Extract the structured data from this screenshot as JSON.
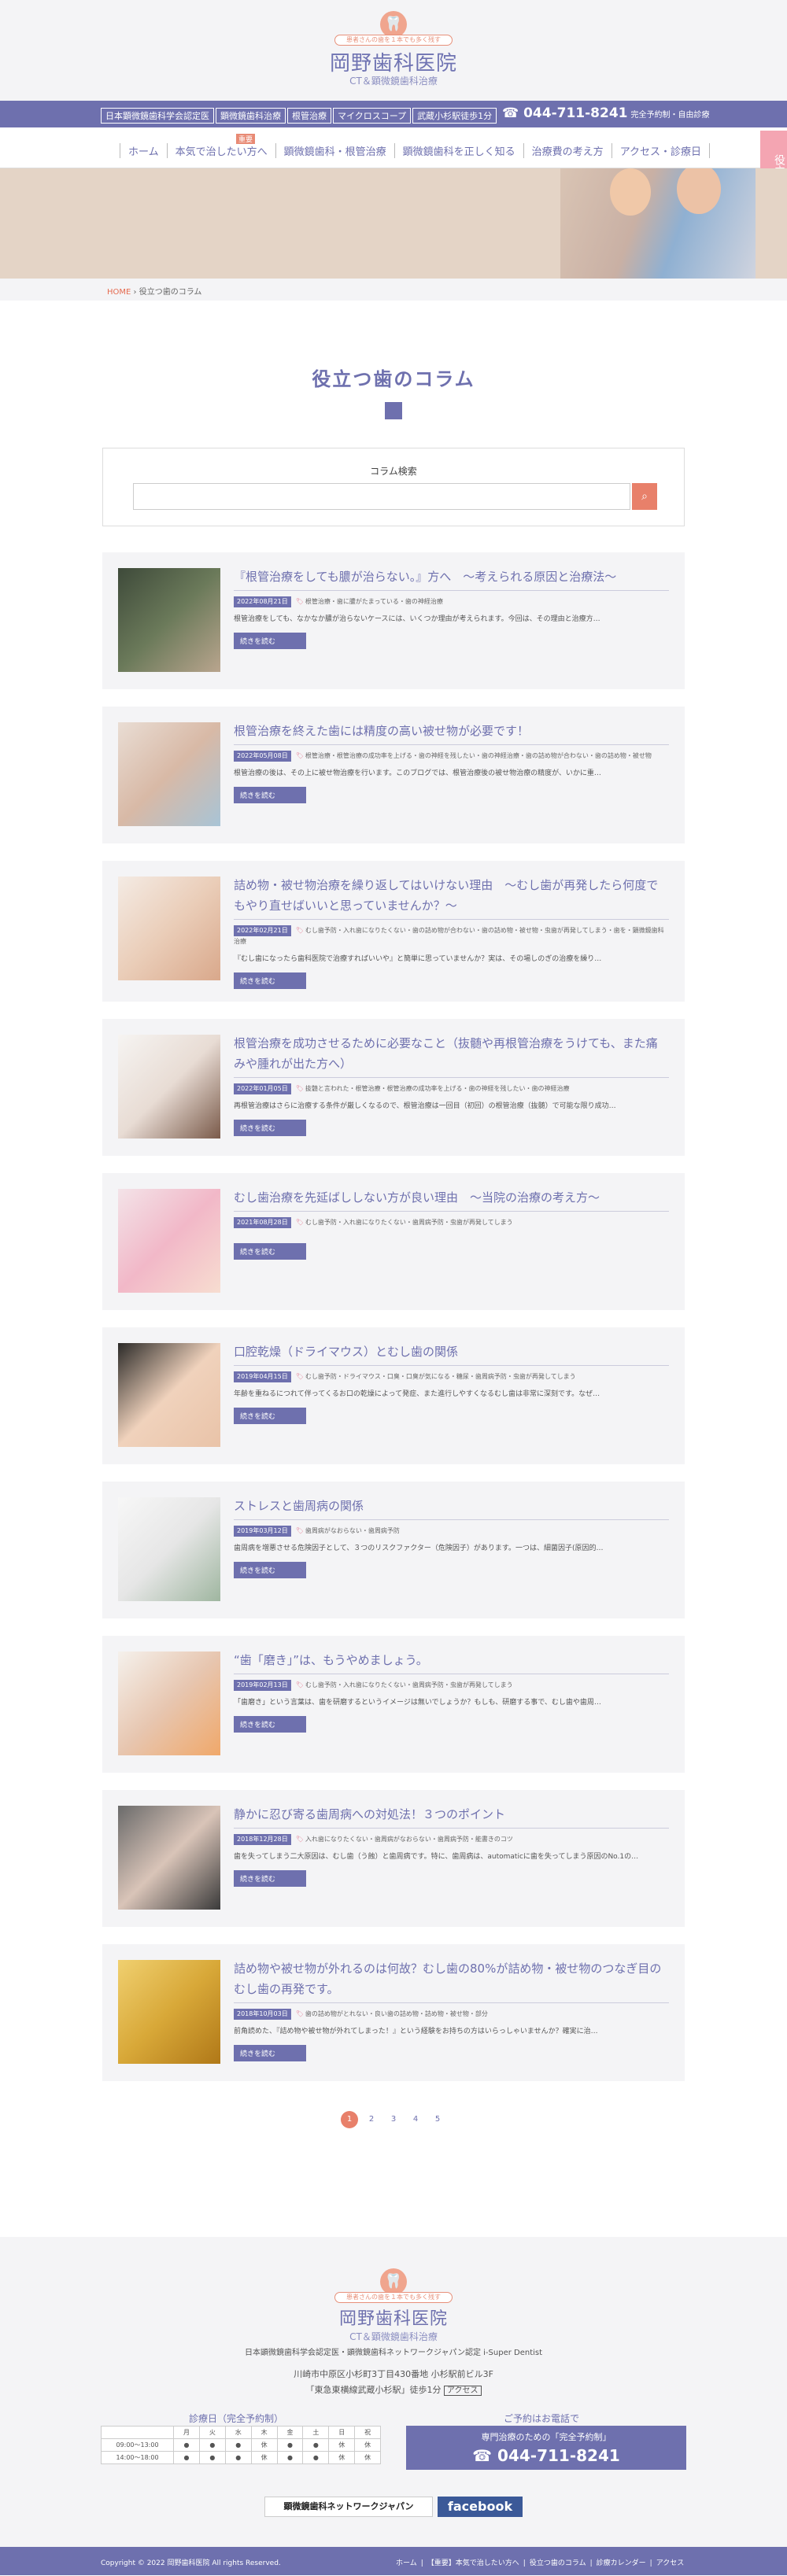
{
  "header": {
    "logo_icon": "tooth",
    "tagline": "患者さんの歯を１本でも多く残す",
    "clinic_name": "岡野歯科医院",
    "clinic_sub": "CT＆顕微鏡歯科治療",
    "tags": [
      "日本顕微鏡歯科学会認定医",
      "顕微鏡歯科治療",
      "根管治療",
      "マイクロスコープ",
      "武蔵小杉駅徒歩1分"
    ],
    "phone": "044-711-8241",
    "phone_note": "完全予約制・自由診療"
  },
  "nav": {
    "items": [
      "ホーム",
      "本気で治したい方へ",
      "顕微鏡歯科・根管治療",
      "顕微鏡歯科を正しく知る",
      "治療費の考え方",
      "アクセス・診療日"
    ],
    "hot_badge": "重要"
  },
  "side_tab": "役立つ歯のコラム",
  "breadcrumb": {
    "home": "HOME",
    "sep": "›",
    "current": "役立つ歯のコラム"
  },
  "page_title": "役立つ歯のコラム",
  "search": {
    "label": "コラム検索",
    "placeholder": "",
    "button_icon": "search-icon"
  },
  "articles": [
    {
      "title": "『根管治療をしても膿が治らない。』方へ　～考えられる原因と治療法～",
      "date": "2022年08月21日",
      "tags": "根管治療・歯に膿がたまっている・歯の神経治療",
      "excerpt": "根管治療をしても、なかなか膿が治らないケースには、いくつか理由が考えられます。今回は、その理由と治療方…",
      "more": "続きを読む"
    },
    {
      "title": "根管治療を終えた歯には精度の高い被せ物が必要です！",
      "date": "2022年05月08日",
      "tags": "根管治療・根管治療の成功率を上げる・歯の神経を残したい・歯の神経治療・歯の詰め物が合わない・歯の詰め物・被せ物",
      "excerpt": "根管治療の後は、その上に被せ物治療を行います。このブログでは、根管治療後の被せ物治療の精度が、いかに重…",
      "more": "続きを読む"
    },
    {
      "title": "詰め物・被せ物治療を繰り返してはいけない理由　～むし歯が再発したら何度でもやり直せばいいと思っていませんか？～",
      "date": "2022年02月21日",
      "tags": "むし歯予防・入れ歯になりたくない・歯の詰め物が合わない・歯の詰め物・被せ物・虫歯が再発してしまう・歯を・顕微鏡歯科治療",
      "excerpt": "『むし歯になったら歯科医院で治療すればいいや』と簡単に思っていませんか？実は、その場しのぎの治療を繰り…",
      "more": "続きを読む"
    },
    {
      "title": "根管治療を成功させるために必要なこと（抜髄や再根管治療をうけても、また痛みや腫れが出た方へ）",
      "date": "2022年01月05日",
      "tags": "抜髄と言われた・根管治療・根管治療の成功率を上げる・歯の神経を残したい・歯の神経治療",
      "excerpt": "再根管治療はさらに治療する条件が厳しくなるので、根管治療は一回目（初回）の根管治療（抜髄）で可能な限り成功…",
      "more": "続きを読む"
    },
    {
      "title": "むし歯治療を先延ばししない方が良い理由　～当院の治療の考え方～",
      "date": "2021年08月28日",
      "tags": "むし歯予防・入れ歯になりたくない・歯周病予防・虫歯が再発してしまう",
      "excerpt": "",
      "more": "続きを読む"
    },
    {
      "title": "口腔乾燥（ドライマウス）とむし歯の関係",
      "date": "2019年04月15日",
      "tags": "むし歯予防・ドライマウス・口臭・口臭が気になる・糖尿・歯周病予防・虫歯が再発してしまう",
      "excerpt": "年齢を重ねるにつれて伴ってくるお口の乾燥によって発症、また進行しやすくなるむし歯は非常に深刻です。なぜ…",
      "more": "続きを読む"
    },
    {
      "title": "ストレスと歯周病の関係",
      "date": "2019年03月12日",
      "tags": "歯周病がなおらない・歯周病予防",
      "excerpt": "歯周病を増悪させる危険因子として、３つのリスクファクター（危険因子）があります。一つは、細菌因子(原因的…",
      "more": "続きを読む"
    },
    {
      "title": "“歯「磨き」”は、もうやめましょう。",
      "date": "2019年02月13日",
      "tags": "むし歯予防・入れ歯になりたくない・歯周病予防・虫歯が再発してしまう",
      "excerpt": "「歯磨き」という言葉は、歯を研磨するというイメージは無いでしょうか？もしも、研磨する事で、むし歯や歯周…",
      "more": "続きを読む"
    },
    {
      "title": "静かに忍び寄る歯周病への対処法！３つのポイント",
      "date": "2018年12月28日",
      "tags": "入れ歯になりたくない・歯周病がなおらない・歯周病予防・能書きのコツ",
      "excerpt": "歯を失ってしまう二大原因は、むし歯（う蝕）と歯周病です。特に、歯周病は、automaticに歯を失ってしまう原因のNo.1の…",
      "more": "続きを読む"
    },
    {
      "title": "詰め物や被せ物が外れるのは何故？むし歯の80%が詰め物・被せ物のつなぎ目のむし歯の再発です。",
      "date": "2018年10月03日",
      "tags": "歯の詰め物がとれない・良い歯の詰め物・詰め物・被せ物・部分",
      "excerpt": "前角読めた、『詰め物や被せ物が外れてしまった！』という経験をお持ちの方はいらっしゃいませんか？確実に治…",
      "more": "続きを読む"
    }
  ],
  "pagination": {
    "pages": [
      "1",
      "2",
      "3",
      "4",
      "5"
    ],
    "current": "1"
  },
  "footer": {
    "tagline": "患者さんの歯を１本でも多く残す",
    "clinic_name": "岡野歯科医院",
    "clinic_sub": "CT＆顕微鏡歯科治療",
    "certification": "日本顕微鏡歯科学会認定医・顕微鏡歯科ネットワークジャパン認定 i-Super Dentist",
    "address": "川崎市中原区小杉町3丁目430番地 小杉駅前ビル3F",
    "station": "「東急東横線武蔵小杉駅」徒歩1分",
    "access_button": "アクセス",
    "schedule_title": "診療日（完全予約制）",
    "schedule_header": [
      "",
      "月",
      "火",
      "水",
      "木",
      "金",
      "土",
      "日",
      "祝"
    ],
    "schedule_rows": [
      [
        "09:00～13:00",
        "●",
        "●",
        "●",
        "休",
        "●",
        "●",
        "休",
        "休"
      ],
      [
        "14:00～18:00",
        "●",
        "●",
        "●",
        "休",
        "●",
        "●",
        "休",
        "休"
      ]
    ],
    "tel_title": "ご予約はお電話で",
    "tel_box_line1": "専門治療のための「完全予約制」",
    "tel_number": "044-711-8241",
    "banner_network": "顕微鏡歯科ネットワークジャパン",
    "banner_facebook": "facebook",
    "copyright": "Copyright © 2022 岡野歯科医院 All rights Reserved.",
    "links": [
      "ホーム",
      "【重要】本気で治したい方へ",
      "役立つ歯のコラム",
      "診療カレンダー",
      "アクセス"
    ]
  },
  "colors": {
    "brand": "#6e70ae",
    "accent": "#e8806a",
    "pink": "#e57f95"
  }
}
